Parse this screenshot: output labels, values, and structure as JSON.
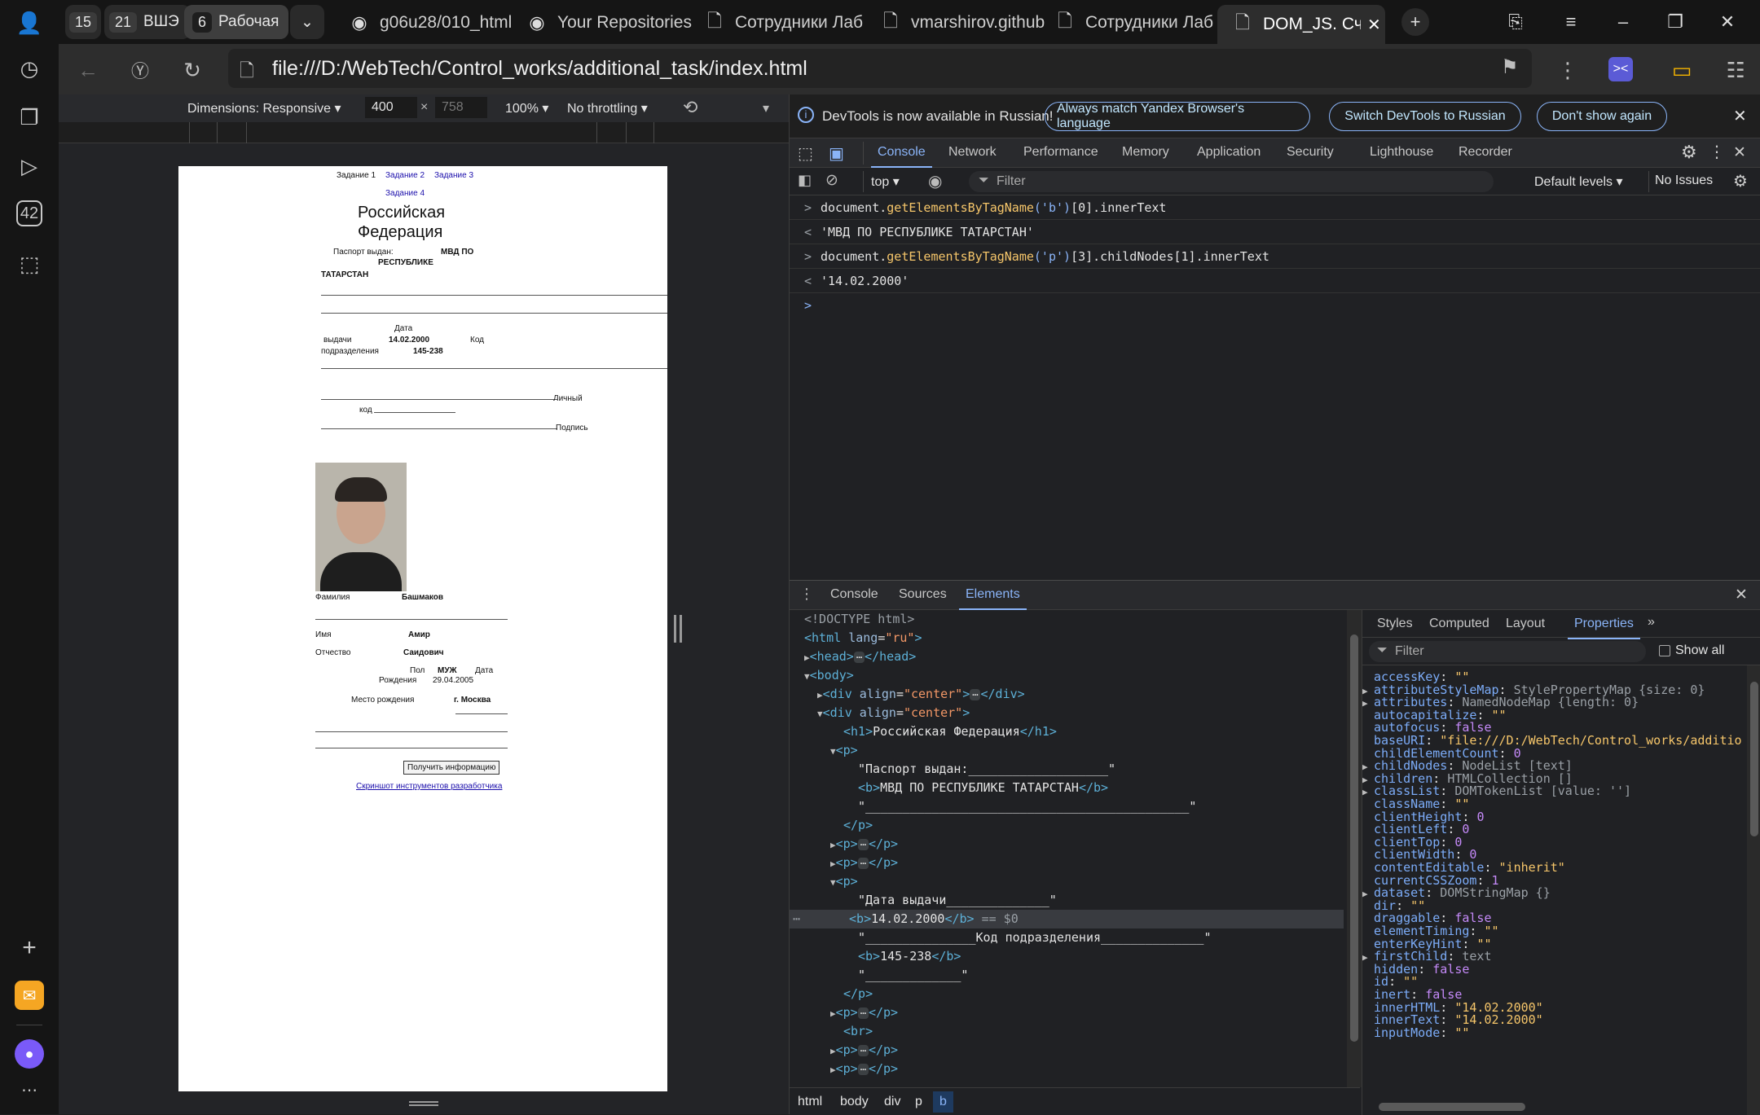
{
  "tabbar": {
    "workspaces": [
      {
        "num": "15",
        "label": ""
      },
      {
        "num": "21",
        "label": "ВШЭ"
      },
      {
        "num": "6",
        "label": "Рабочая"
      }
    ],
    "tabs": [
      {
        "title": "g06u28/010_html",
        "icon": "github-icon"
      },
      {
        "title": "Your Repositories",
        "icon": "github-icon"
      },
      {
        "title": "Сотрудники Лаб",
        "icon": "document-icon"
      },
      {
        "title": "vmarshirov.github",
        "icon": "document-icon"
      },
      {
        "title": "Сотрудники Лаб",
        "icon": "document-icon"
      },
      {
        "title": "DOM_JS. Считыв",
        "icon": "document-icon"
      }
    ]
  },
  "rail": {
    "badge": "42"
  },
  "address": {
    "url": "file:///D:/WebTech/Control_works/additional_task/index.html"
  },
  "device_toolbar": {
    "dimensions": "Dimensions: Responsive",
    "width": "400",
    "height": "758",
    "times": "×",
    "zoom": "100%",
    "throttling": "No throttling"
  },
  "page": {
    "nav": [
      "Задание 1",
      "Задание 2",
      "Задание 3",
      "Задание 4"
    ],
    "heading_line1": "Российская",
    "heading_line2": "Федерация",
    "issued_label": "Паспорт выдан:",
    "issued_value1": "МВД ПО",
    "issued_value2": "РЕСПУБЛИКЕ",
    "issued_value3": "ТАТАРСТАН",
    "date_label": "Дата",
    "date_label2": "выдачи",
    "date_value": "14.02.2000",
    "code_label": "Код",
    "code_label2": "подразделения",
    "code_value": "145-238",
    "personal_label": "Личный",
    "personal_label2": "код",
    "signature_label": "Подпись",
    "surname_label": "Фамилия",
    "surname_value": "Башмаков",
    "name_label": "Имя",
    "name_value": "Амир",
    "patronymic_label": "Отчество",
    "patronymic_value": "Саидович",
    "sex_label": "Пол",
    "sex_value": "МУЖ",
    "birth_label": "Дата",
    "birth_label2": "Рождения",
    "birth_value": "29.04.2005",
    "place_label": "Место рождения",
    "place_value": "г. Москва",
    "button": "Получить информацию",
    "link": "Скриншот инструментов разработчика"
  },
  "devtools": {
    "info": {
      "text": "DevTools is now available in Russian!",
      "btn_match": "Always match Yandex Browser's language",
      "btn_switch": "Switch DevTools to Russian",
      "btn_dont": "Don't show again"
    },
    "tabs": [
      "Console",
      "Network",
      "Performance",
      "Memory",
      "Application",
      "Security",
      "Lighthouse",
      "Recorder"
    ],
    "console_toolbar": {
      "context": "top",
      "filter": "Filter",
      "levels": "Default levels",
      "issues": "No Issues"
    },
    "console": [
      {
        "kind": "input",
        "pre": "document.",
        "fn": "getElementsByTagName",
        "arg": "('b')",
        "post": "[0].innerText"
      },
      {
        "kind": "output",
        "value": "'МВД ПО РЕСПУБЛИКЕ ТАТАРСТАН'"
      },
      {
        "kind": "input",
        "pre": "document.",
        "fn": "getElementsByTagName",
        "arg": "('p')",
        "post": "[3].childNodes[1].innerText"
      },
      {
        "kind": "output",
        "value": "'14.02.2000'"
      }
    ],
    "drawer_tabs": [
      "Console",
      "Sources",
      "Elements"
    ],
    "elements": {
      "doctype": "<!DOCTYPE html>",
      "h1_text": "Российская Федерация",
      "passport_text": "\"Паспорт выдан:___________________\"",
      "b1_text": "МВД ПО РЕСПУБЛИКЕ ТАТАРСТАН",
      "underscores": "\"____________________________________________\"",
      "date_text": "\"Дата выдачи______________\"",
      "b2_text": "14.02.2000",
      "eq": "== $0",
      "code_text": "\"_______________Код подразделения______________\"",
      "b3_text": "145-238",
      "under_end": "\"_____________\"",
      "script_src": "get_data.js"
    },
    "breadcrumb": [
      "html",
      "body",
      "div",
      "p",
      "b"
    ],
    "side_tabs": [
      "Styles",
      "Computed",
      "Layout",
      "Properties"
    ],
    "side_filter": "Filter",
    "show_all": "Show all",
    "properties": [
      {
        "k": "accessKey",
        "v": "\"\"",
        "t": "str",
        "exp": false
      },
      {
        "k": "attributeStyleMap",
        "v": "StylePropertyMap {size: 0}",
        "t": "obj",
        "exp": true
      },
      {
        "k": "attributes",
        "v": "NamedNodeMap {length: 0}",
        "t": "obj",
        "exp": true
      },
      {
        "k": "autocapitalize",
        "v": "\"\"",
        "t": "str",
        "exp": false
      },
      {
        "k": "autofocus",
        "v": "false",
        "t": "kw",
        "exp": false
      },
      {
        "k": "baseURI",
        "v": "\"file:///D:/WebTech/Control_works/additio",
        "t": "str",
        "exp": false
      },
      {
        "k": "childElementCount",
        "v": "0",
        "t": "num",
        "exp": false
      },
      {
        "k": "childNodes",
        "v": "NodeList [text]",
        "t": "obj",
        "exp": true
      },
      {
        "k": "children",
        "v": "HTMLCollection []",
        "t": "obj",
        "exp": true
      },
      {
        "k": "classList",
        "v": "DOMTokenList [value: '']",
        "t": "obj",
        "exp": true
      },
      {
        "k": "className",
        "v": "\"\"",
        "t": "str",
        "exp": false
      },
      {
        "k": "clientHeight",
        "v": "0",
        "t": "num",
        "exp": false
      },
      {
        "k": "clientLeft",
        "v": "0",
        "t": "num",
        "exp": false
      },
      {
        "k": "clientTop",
        "v": "0",
        "t": "num",
        "exp": false
      },
      {
        "k": "clientWidth",
        "v": "0",
        "t": "num",
        "exp": false
      },
      {
        "k": "contentEditable",
        "v": "\"inherit\"",
        "t": "str",
        "exp": false
      },
      {
        "k": "currentCSSZoom",
        "v": "1",
        "t": "num",
        "exp": false
      },
      {
        "k": "dataset",
        "v": "DOMStringMap {}",
        "t": "obj",
        "exp": true
      },
      {
        "k": "dir",
        "v": "\"\"",
        "t": "str",
        "exp": false
      },
      {
        "k": "draggable",
        "v": "false",
        "t": "kw",
        "exp": false
      },
      {
        "k": "elementTiming",
        "v": "\"\"",
        "t": "str",
        "exp": false
      },
      {
        "k": "enterKeyHint",
        "v": "\"\"",
        "t": "str",
        "exp": false
      },
      {
        "k": "firstChild",
        "v": "text",
        "t": "obj",
        "exp": true
      },
      {
        "k": "hidden",
        "v": "false",
        "t": "kw",
        "exp": false
      },
      {
        "k": "id",
        "v": "\"\"",
        "t": "str",
        "exp": false
      },
      {
        "k": "inert",
        "v": "false",
        "t": "kw",
        "exp": false
      },
      {
        "k": "innerHTML",
        "v": "\"14.02.2000\"",
        "t": "str",
        "exp": false
      },
      {
        "k": "innerText",
        "v": "\"14.02.2000\"",
        "t": "str",
        "exp": false
      },
      {
        "k": "inputMode",
        "v": "\"\"",
        "t": "str",
        "exp": false
      }
    ]
  }
}
